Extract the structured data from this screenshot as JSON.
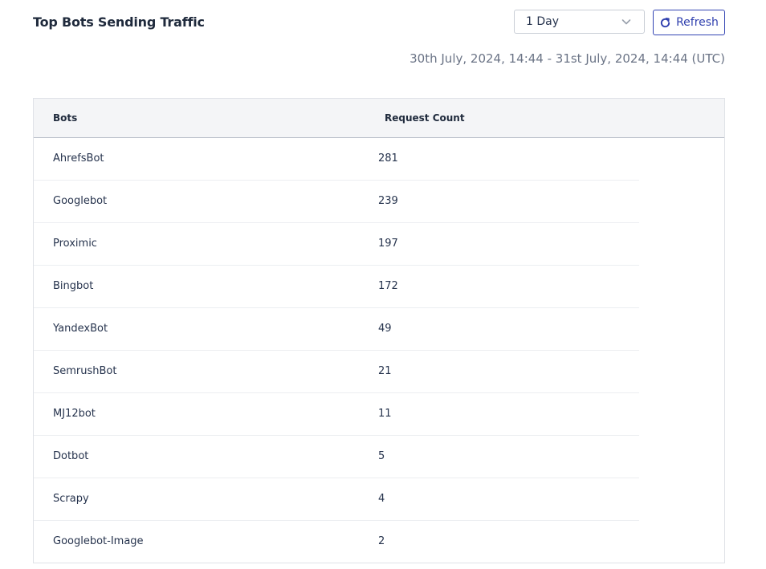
{
  "header": {
    "title": "Top Bots Sending Traffic",
    "period_select": {
      "value": "1 Day"
    },
    "refresh_label": "Refresh",
    "date_range": "30th July, 2024, 14:44 - 31st July, 2024, 14:44 (UTC)"
  },
  "table": {
    "columns": [
      "Bots",
      "Request Count"
    ],
    "rows": [
      {
        "bot": "AhrefsBot",
        "count": "281"
      },
      {
        "bot": "Googlebot",
        "count": "239"
      },
      {
        "bot": "Proximic",
        "count": "197"
      },
      {
        "bot": "Bingbot",
        "count": "172"
      },
      {
        "bot": "YandexBot",
        "count": "49"
      },
      {
        "bot": "SemrushBot",
        "count": "21"
      },
      {
        "bot": "MJ12bot",
        "count": "11"
      },
      {
        "bot": "Dotbot",
        "count": "5"
      },
      {
        "bot": "Scrapy",
        "count": "4"
      },
      {
        "bot": "Googlebot-Image",
        "count": "2"
      }
    ]
  },
  "colors": {
    "accent": "#2f3fae",
    "header_bg": "#f4f5f7",
    "text": "#26334d",
    "muted": "#6b7486"
  },
  "icons": {
    "select": "chevron-down-icon",
    "refresh": "refresh-icon"
  }
}
